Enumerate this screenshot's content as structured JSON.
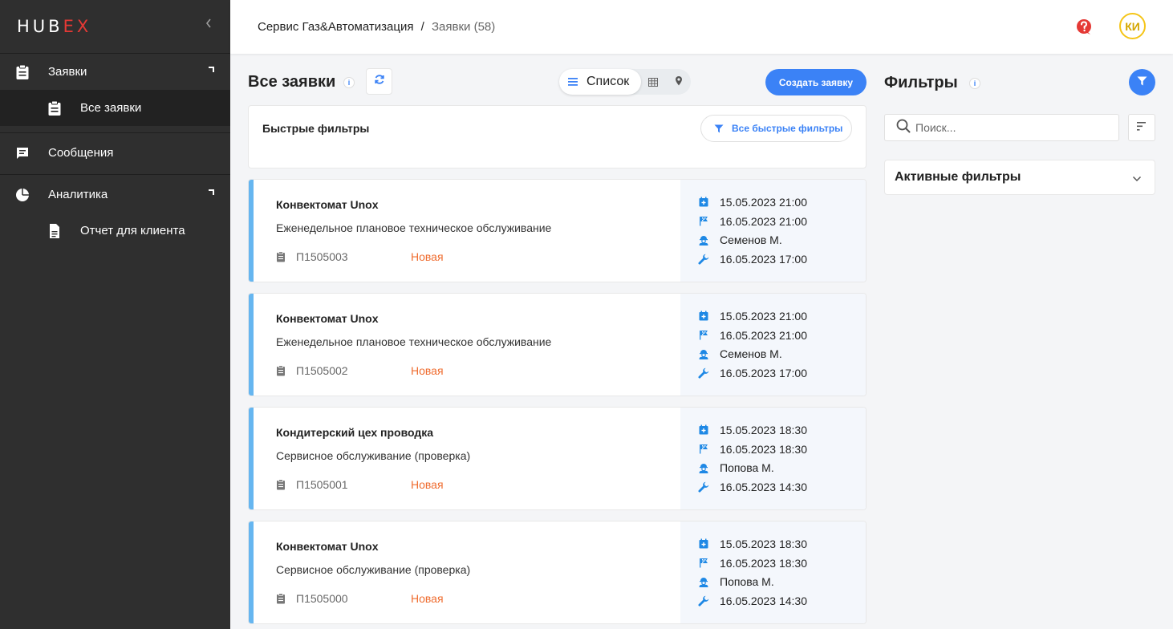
{
  "app": {
    "logo_hu": "HU",
    "logo_b": "B",
    "logo_ex": "EX"
  },
  "sidebar": {
    "items": [
      {
        "label": "Заявки",
        "icon": "clipboard-icon"
      },
      {
        "label": "Все заявки",
        "icon": "clipboard-icon"
      },
      {
        "label": "Сообщения",
        "icon": "message-icon"
      },
      {
        "label": "Аналитика",
        "icon": "pie-chart-icon"
      },
      {
        "label": "Отчет для клиента",
        "icon": "document-icon"
      }
    ]
  },
  "header": {
    "breadcrumb_company": "Сервис Газ&Автоматизация",
    "breadcrumb_sep": "/",
    "breadcrumb_current": "Заявки (58)",
    "avatar_initials": "КИ"
  },
  "main": {
    "title": "Все заявки",
    "view_list_label": "Список",
    "create_button": "Создать заявку",
    "quick_filters_title": "Быстрые фильтры",
    "quick_filters_button": "Все быстрые фильтры"
  },
  "cards": [
    {
      "title": "Конвектомат Unox",
      "description": "Еженедельное плановое техническое обслуживание",
      "id": "П1505003",
      "status": "Новая",
      "created": "15.05.2023 21:00",
      "deadline": "16.05.2023 21:00",
      "engineer": "Семенов М.",
      "work_date": "16.05.2023 17:00"
    },
    {
      "title": "Конвектомат Unox",
      "description": "Еженедельное плановое техническое обслуживание",
      "id": "П1505002",
      "status": "Новая",
      "created": "15.05.2023 21:00",
      "deadline": "16.05.2023 21:00",
      "engineer": "Семенов М.",
      "work_date": "16.05.2023 17:00"
    },
    {
      "title": "Кондитерский цех проводка",
      "description": "Сервисное обслуживание (проверка)",
      "id": "П1505001",
      "status": "Новая",
      "created": "15.05.2023 18:30",
      "deadline": "16.05.2023 18:30",
      "engineer": "Попова М.",
      "work_date": "16.05.2023 14:30"
    },
    {
      "title": "Конвектомат Unox",
      "description": "Сервисное обслуживание (проверка)",
      "id": "П1505000",
      "status": "Новая",
      "created": "15.05.2023 18:30",
      "deadline": "16.05.2023 18:30",
      "engineer": "Попова М.",
      "work_date": "16.05.2023 14:30"
    }
  ],
  "filters": {
    "title": "Фильтры",
    "search_placeholder": "Поиск...",
    "active_filters_label": "Активные фильтры"
  },
  "colors": {
    "sidebar_bg": "#2f2f2f",
    "accent": "#3b82f6",
    "status_new": "#ef6c2f",
    "card_accent": "#66b6f0",
    "logo_red": "#e53935"
  }
}
